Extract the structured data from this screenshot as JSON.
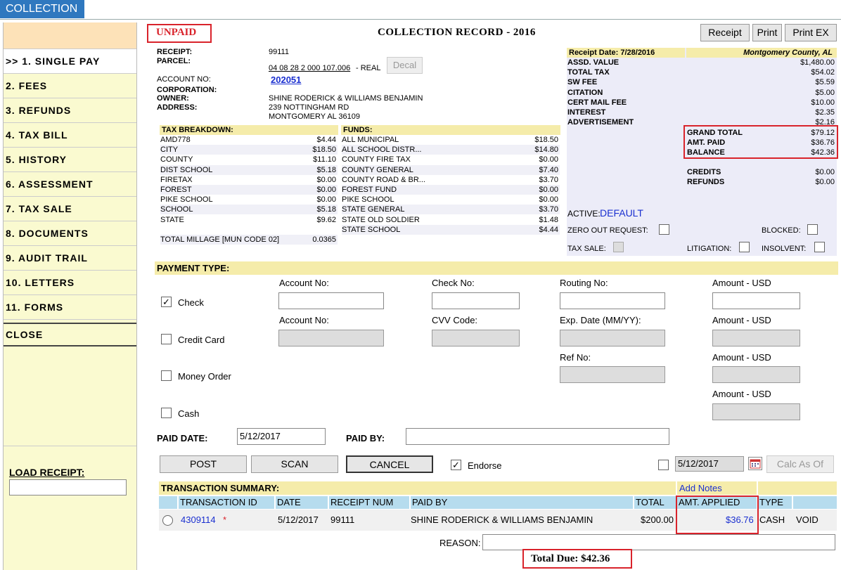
{
  "app": {
    "tab": "COLLECTION"
  },
  "nav": {
    "items": [
      ">> 1. SINGLE PAY",
      "2. FEES",
      "3. REFUNDS",
      "4. TAX BILL",
      "5. HISTORY",
      "6. ASSESSMENT",
      "7. TAX SALE",
      "8. DOCUMENTS",
      "9. AUDIT TRAIL",
      "10. LETTERS",
      "11. FORMS"
    ],
    "close": "CLOSE",
    "load_receipt": "LOAD RECEIPT:"
  },
  "header": {
    "status": "UNPAID",
    "title": "COLLECTION RECORD - 2016",
    "buttons": [
      "Receipt",
      "Print",
      "Print EX"
    ]
  },
  "info": {
    "receipt_label": "RECEIPT:",
    "receipt": "99111",
    "parcel_label": "PARCEL:",
    "parcel": "04 08 28 2 000 107.006",
    "parcel_type": "- REAL",
    "decal": "Decal",
    "account_label": "ACCOUNT NO:",
    "account": "202051",
    "corp_label": "CORPORATION:",
    "owner_label": "OWNER:",
    "owner": "SHINE RODERICK & WILLIAMS BENJAMIN",
    "address_label": "ADDRESS:",
    "address1": "239 NOTTINGHAM RD",
    "address2": "MONTGOMERY AL  36109"
  },
  "tax": {
    "header": "TAX BREAKDOWN:",
    "items": [
      [
        "AMD778",
        "$4.44"
      ],
      [
        "CITY",
        "$18.50"
      ],
      [
        "COUNTY",
        "$11.10"
      ],
      [
        "DIST SCHOOL",
        "$5.18"
      ],
      [
        "FIRETAX",
        "$0.00"
      ],
      [
        "FOREST",
        "$0.00"
      ],
      [
        "PIKE SCHOOL",
        "$0.00"
      ],
      [
        "SCHOOL",
        "$5.18"
      ],
      [
        "STATE",
        "$9.62"
      ]
    ],
    "millage_label": "TOTAL MILLAGE [MUN CODE 02]",
    "millage": "0.0365"
  },
  "funds": {
    "header": "FUNDS:",
    "items": [
      [
        "ALL MUNICIPAL",
        "$18.50"
      ],
      [
        "ALL SCHOOL DISTR...",
        "$14.80"
      ],
      [
        "COUNTY FIRE TAX",
        "$0.00"
      ],
      [
        "COUNTY GENERAL",
        "$7.40"
      ],
      [
        "COUNTY ROAD & BR...",
        "$3.70"
      ],
      [
        "FOREST FUND",
        "$0.00"
      ],
      [
        "PIKE SCHOOL",
        "$0.00"
      ],
      [
        "STATE GENERAL",
        "$3.70"
      ],
      [
        "STATE OLD SOLDIER",
        "$1.48"
      ],
      [
        "STATE SCHOOL",
        "$4.44"
      ]
    ]
  },
  "summary": {
    "receipt_date": "Receipt Date: 7/28/2016",
    "county": "Montgomery County, AL",
    "items": [
      [
        "ASSD. VALUE",
        "$1,480.00"
      ],
      [
        "TOTAL TAX",
        "$54.02"
      ],
      [
        "SW FEE",
        "$5.59"
      ],
      [
        "CITATION",
        "$5.00"
      ],
      [
        "CERT MAIL FEE",
        "$10.00"
      ],
      [
        "INTEREST",
        "$2.35"
      ],
      [
        "ADVERTISEMENT",
        "$2.16"
      ]
    ],
    "totals": [
      [
        "GRAND TOTAL",
        "$79.12"
      ],
      [
        "AMT. PAID",
        "$36.76"
      ],
      [
        "BALANCE",
        "$42.36"
      ]
    ],
    "credits": [
      [
        "CREDITS",
        "$0.00"
      ],
      [
        "REFUNDS",
        "$0.00"
      ]
    ],
    "active_label": "ACTIVE:",
    "active": "DEFAULT",
    "zero_out": "ZERO OUT REQUEST:",
    "blocked": "BLOCKED:",
    "tax_sale": "TAX SALE:",
    "litigation": "LITIGATION:",
    "insolvent": "INSOLVENT:"
  },
  "payment": {
    "header": "PAYMENT TYPE:",
    "check": "Check",
    "credit": "Credit Card",
    "money_order": "Money Order",
    "cash": "Cash",
    "account_no": "Account No:",
    "check_no": "Check No:",
    "routing_no": "Routing No:",
    "amount": "Amount - USD",
    "cvv": "CVV Code:",
    "exp": "Exp. Date (MM/YY):",
    "ref": "Ref No:",
    "paid_date_label": "PAID DATE:",
    "paid_date": "5/12/2017",
    "paid_by_label": "PAID BY:",
    "post": "POST",
    "scan": "SCAN",
    "cancel": "CANCEL",
    "endorse": "Endorse",
    "calc_date": "5/12/2017",
    "calc": "Calc As Of"
  },
  "transactions": {
    "header": "TRANSACTION SUMMARY:",
    "add_notes": "Add Notes",
    "columns": [
      "TRANSACTION ID",
      "DATE",
      "RECEIPT NUM",
      "PAID BY",
      "TOTAL",
      "AMT. APPLIED",
      "TYPE"
    ],
    "row": {
      "id": "4309114",
      "star": "*",
      "date": "5/12/2017",
      "receipt": "99111",
      "paid_by": "SHINE RODERICK & WILLIAMS BENJAMIN",
      "total": "$200.00",
      "applied": "$36.76",
      "type": "CASH",
      "void": "VOID"
    },
    "reason": "REASON:",
    "total_due": "Total Due: $42.36"
  }
}
